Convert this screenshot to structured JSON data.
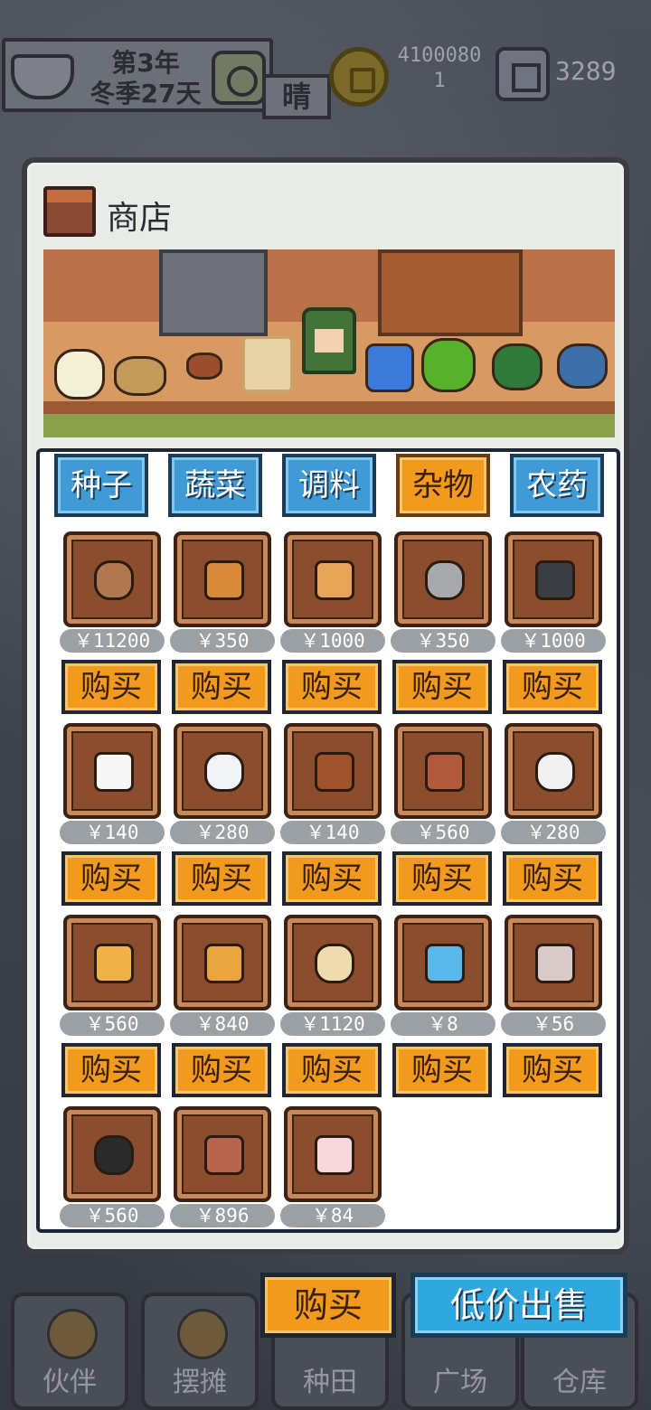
{
  "status_bar": {
    "year": "第3年",
    "season_day": "冬季27天",
    "weather": "晴",
    "money": "41000801",
    "gems": "3289"
  },
  "shop": {
    "title": "商店",
    "tabs": [
      {
        "label": "种子",
        "active": false
      },
      {
        "label": "蔬菜",
        "active": false
      },
      {
        "label": "调料",
        "active": false
      },
      {
        "label": "杂物",
        "active": true
      },
      {
        "label": "农药",
        "active": false
      }
    ],
    "buy_label": "购买",
    "items": [
      {
        "icon": "ginger-root-icon",
        "price": "￥11200",
        "color": "#b07850"
      },
      {
        "icon": "cinnamon-stick-icon",
        "price": "￥350",
        "color": "#d9893a"
      },
      {
        "icon": "cheese-wedge-icon",
        "price": "￥1000",
        "color": "#e7a55a"
      },
      {
        "icon": "stone-icon",
        "price": "￥350",
        "color": "#a7a9ad"
      },
      {
        "icon": "iron-ore-icon",
        "price": "￥1000",
        "color": "#3c3d42"
      },
      {
        "icon": "egg-icon",
        "price": "￥140",
        "color": "#f6f6f6"
      },
      {
        "icon": "milk-bottle-icon",
        "price": "￥280",
        "color": "#f2f4f7"
      },
      {
        "icon": "mushroom-icon",
        "price": "￥140",
        "color": "#a0522d"
      },
      {
        "icon": "meat-icon",
        "price": "￥560",
        "color": "#b25a3c"
      },
      {
        "icon": "speech-bubble-icon",
        "price": "￥280",
        "color": "#f0f0f0"
      },
      {
        "icon": "cheese-block-icon",
        "price": "￥560",
        "color": "#f2b24a"
      },
      {
        "icon": "oil-jar-icon",
        "price": "￥840",
        "color": "#e9a640"
      },
      {
        "icon": "tofu-icon",
        "price": "￥1120",
        "color": "#efdcae"
      },
      {
        "icon": "water-drop-icon",
        "price": "￥8",
        "color": "#5ab8ea"
      },
      {
        "icon": "flour-sack-icon",
        "price": "￥56",
        "color": "#d9c9c9"
      },
      {
        "icon": "seaweed-icon",
        "price": "￥560",
        "color": "#2a2a2a"
      },
      {
        "icon": "sausage-icon",
        "price": "￥896",
        "color": "#b8644e"
      },
      {
        "icon": "rice-ball-icon",
        "price": "￥84",
        "color": "#f6d7dc"
      }
    ]
  },
  "actions": {
    "buy": "购买",
    "sell": "低价出售"
  },
  "nav": [
    {
      "label": "伙伴",
      "icon": "return-arrow-icon"
    },
    {
      "label": "摆摊",
      "icon": "stall-icon"
    },
    {
      "label": "种田",
      "icon": "farm-icon"
    },
    {
      "label": "广场",
      "icon": "plaza-icon"
    },
    {
      "label": "仓库",
      "icon": "warehouse-icon"
    }
  ]
}
